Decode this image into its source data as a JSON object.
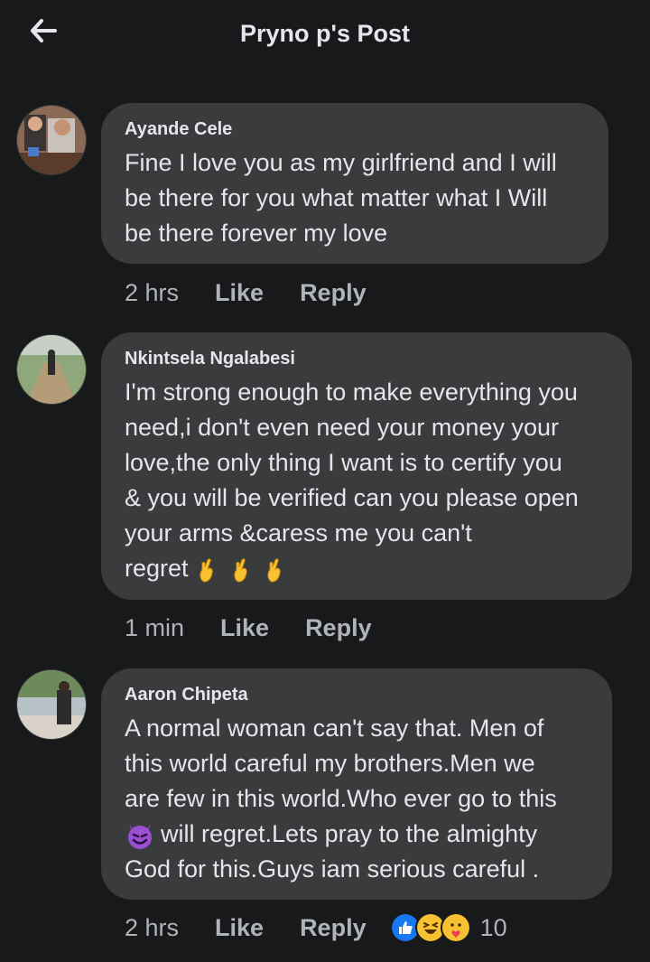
{
  "header": {
    "title": "Pryno p's Post",
    "back_icon": "arrow-left-icon"
  },
  "comments": [
    {
      "author": "Ayande Cele",
      "lines": [
        "Fine I love you as my girlfriend and I will",
        "be there for you what matter what I Will",
        "be there forever my love"
      ],
      "time": "2 hrs",
      "like": "Like",
      "reply": "Reply"
    },
    {
      "author": "Nkintsela Ngalabesi",
      "lines": [
        "I'm strong enough to make everything you",
        "need,i don't even need your money your",
        "love,the only thing I want is to certify you",
        "& you will be verified can you please open",
        "your arms &caress me you can't",
        "regret"
      ],
      "emoji_after": [
        "crossed-fingers-icon",
        "crossed-fingers-icon",
        "crossed-fingers-icon"
      ],
      "time": "1 min",
      "like": "Like",
      "reply": "Reply"
    },
    {
      "author": "Aaron Chipeta",
      "lines": [
        "A normal woman can't say that. Men of",
        "this world careful my brothers.Men we",
        "are few in this world.Who ever go to this",
        "will regret.Lets pray to the almighty",
        "God for this.Guys iam serious careful ."
      ],
      "inline_emoji": "smiling-devil-icon",
      "time": "2 hrs",
      "like": "Like",
      "reply": "Reply",
      "reactions": {
        "icons": [
          "like-reaction-icon",
          "haha-reaction-icon",
          "care-reaction-icon"
        ],
        "count": "10"
      }
    }
  ],
  "colors": {
    "background": "#18191a",
    "bubble": "#3a3b3c",
    "text": "#e4e6eb",
    "meta": "#b0b3b8",
    "like_blue": "#1877f2"
  }
}
